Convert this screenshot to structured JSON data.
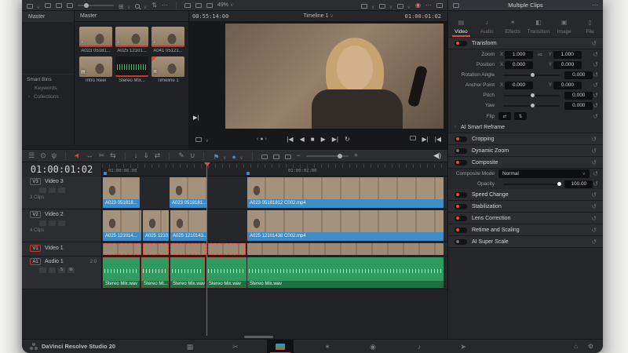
{
  "colors": {
    "accent_red": "#e5483e",
    "clip_blue": "#3f8dc6",
    "audio_green": "#2f9b5e",
    "app_bg": "#1e2023"
  },
  "icons": {
    "chevron_down": "∨",
    "chevron_right": "›",
    "more": "⋯",
    "note": "♪",
    "flag": "⚑",
    "marker": "●",
    "reset": "↺",
    "link": "∞",
    "play": "▶",
    "reverse": "◀",
    "stop": "■",
    "first_frame": "|◀",
    "last_frame": "▶|",
    "loop": "↻",
    "jog": "‹ ● ›",
    "cursor": "➤",
    "scissors": "✂",
    "pen": "✎",
    "home": "⌂",
    "gear": "⚙",
    "grid": "⊞",
    "sort": "⇅",
    "flip_h": "⇄",
    "flip_v": "⇅",
    "menu": "☰",
    "eye": "⊙",
    "mic": "ψ",
    "trim": "↔",
    "dyn_trim": "⇆",
    "insert": "↓",
    "overwrite": "⇓",
    "replace": "⇄",
    "snap": "∪",
    "tab_video": "▤",
    "tab_audio": "♪",
    "tab_effects": "✶",
    "tab_transition": "◧",
    "tab_image": "▣",
    "tab_file": "▯",
    "page_media": "▦",
    "page_cut": "✂",
    "page_fusion": "✶",
    "page_color": "◉",
    "page_fairlight": "♪",
    "page_deliver": "➤"
  },
  "topbar": {
    "zoom_level": "49%"
  },
  "media_pool": {
    "bin_list_title": "Master",
    "current_bin": "Master",
    "sidebar": {
      "smart_bins": "Smart Bins",
      "keywords": "Keywords",
      "collections": "Collections"
    },
    "clips": [
      {
        "name": "A023 05181..."
      },
      {
        "name": "A025 12101..."
      },
      {
        "name": "A041 05121..."
      },
      {
        "name": "Intro Reel"
      },
      {
        "name": "Stereo Mix..."
      },
      {
        "name": "Timeline 1"
      }
    ]
  },
  "viewer": {
    "left_timecode": "00:55:14:00",
    "timeline_name": "Timeline 1",
    "right_timecode": "01:00:01:02"
  },
  "inspector": {
    "title": "Multiple Clips",
    "tabs": {
      "video": "Video",
      "audio": "Audio",
      "effects": "Effects",
      "transition": "Transition",
      "image": "Image",
      "file": "File"
    },
    "transform": {
      "title": "Transform",
      "x_label": "X",
      "y_label": "Y",
      "zoom": {
        "label": "Zoom",
        "x": "1.000",
        "y": "1.000"
      },
      "position": {
        "label": "Position",
        "x": "0.000",
        "y": "0.000"
      },
      "rotation": {
        "label": "Rotation Angle",
        "value": "0.000"
      },
      "anchor": {
        "label": "Anchor Point",
        "x": "0.000",
        "y": "0.000"
      },
      "pitch": {
        "label": "Pitch",
        "value": "0.000"
      },
      "yaw": {
        "label": "Yaw",
        "value": "0.000"
      },
      "flip": {
        "label": "Flip"
      }
    },
    "sections": {
      "ai_smart_reframe": "AI Smart Reframe",
      "cropping": "Cropping",
      "dynamic_zoom": "Dynamic Zoom",
      "composite": "Composite",
      "composite_mode_label": "Composite Mode",
      "composite_mode_value": "Normal",
      "opacity_label": "Opacity",
      "opacity_value": "100.00",
      "speed_change": "Speed Change",
      "stabilization": "Stabilization",
      "lens_correction": "Lens Correction",
      "retime_scaling": "Retime and Scaling",
      "ai_super_scale": "AI Super Scale"
    }
  },
  "timeline": {
    "timecode": "01:00:01:02",
    "ruler": {
      "start": "01:00:00:00",
      "mid": "01:00:02:00"
    },
    "tracks": [
      {
        "id": "V3",
        "name": "Video 3",
        "info": "3 Clips"
      },
      {
        "id": "V2",
        "name": "Video 2",
        "info": "4 Clips"
      },
      {
        "id": "V1",
        "name": "Video 1"
      },
      {
        "id": "A1",
        "name": "Audio 1",
        "channels": "2.0"
      }
    ],
    "track_buttons": {
      "solo": "S",
      "mute": "M"
    },
    "clips": {
      "v3": [
        {
          "label": "A023 051818..."
        },
        {
          "label": "A023 0518181..."
        },
        {
          "label": "A023 05181812 C002.mp4"
        }
      ],
      "v2": [
        {
          "label": "A025 121014..."
        },
        {
          "label": "A025 1210..."
        },
        {
          "label": "A025 1210143..."
        },
        {
          "label": "A025 12101438 C002.mp4"
        }
      ],
      "a1": [
        {
          "label": "Stereo Mix.wav"
        },
        {
          "label": "Stereo Mi..."
        },
        {
          "label": "Stereo Mix.wav"
        },
        {
          "label": "Stereo Mix.wav"
        },
        {
          "label": "Stereo Mix.wav"
        }
      ]
    }
  },
  "bottom_bar": {
    "app_name": "DaVinci Resolve Studio 20"
  }
}
